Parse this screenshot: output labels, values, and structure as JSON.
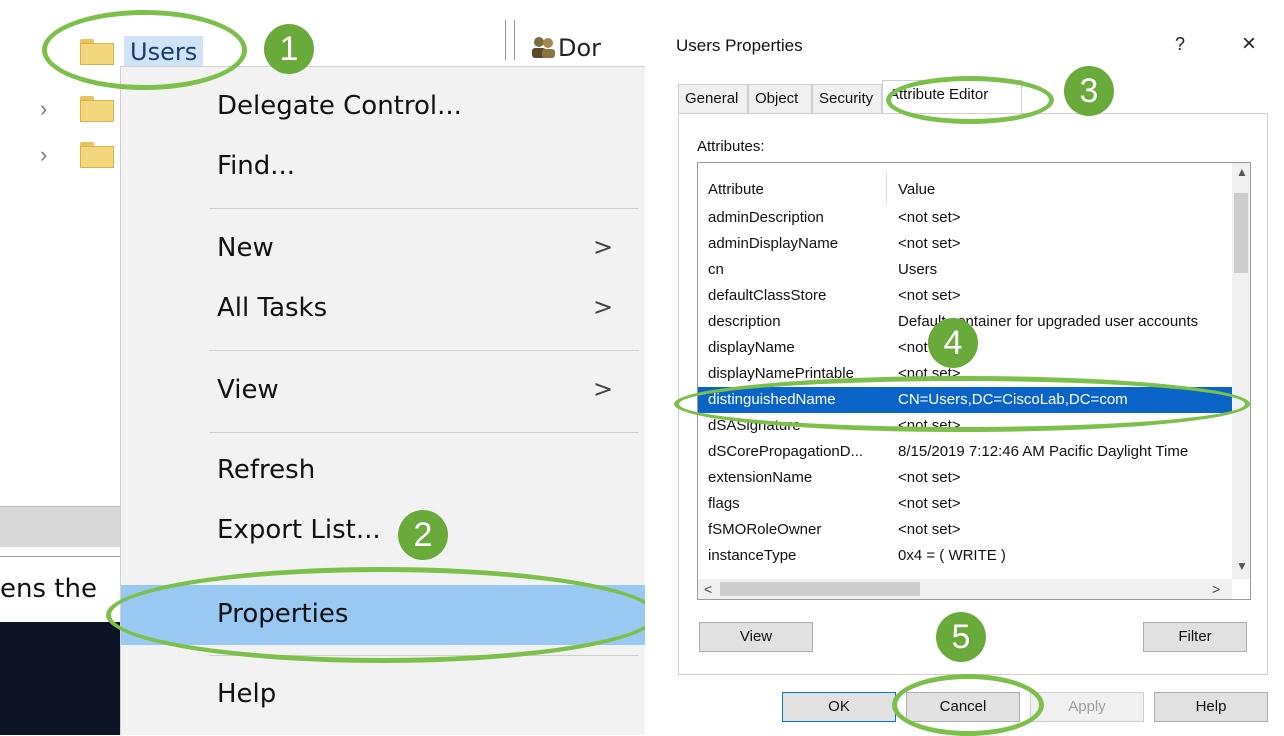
{
  "left": {
    "tree": {
      "selected_label": "Users"
    },
    "console_partial": {
      "column_header": "Dor",
      "status_text": "ens the"
    },
    "context_menu": {
      "items": [
        {
          "label": "Delegate Control...",
          "submenu": false
        },
        {
          "label": "Find...",
          "submenu": false
        },
        {
          "label": "New",
          "submenu": true
        },
        {
          "label": "All Tasks",
          "submenu": true
        },
        {
          "label": "View",
          "submenu": true
        },
        {
          "label": "Refresh",
          "submenu": false
        },
        {
          "label": "Export List...",
          "submenu": false
        },
        {
          "label": "Properties",
          "submenu": false,
          "highlighted": true
        },
        {
          "label": "Help",
          "submenu": false
        }
      ],
      "submenu_arrow": ">"
    }
  },
  "dialog": {
    "title": "Users Properties",
    "help_glyph": "?",
    "close_glyph": "×",
    "tabs": [
      "General",
      "Object",
      "Security",
      "Attribute Editor"
    ],
    "active_tab": "Attribute Editor",
    "attributes_label": "Attributes:",
    "columns": {
      "attribute": "Attribute",
      "value": "Value"
    },
    "rows": [
      {
        "attribute": "adminDescription",
        "value": "<not set>"
      },
      {
        "attribute": "adminDisplayName",
        "value": "<not set>"
      },
      {
        "attribute": "cn",
        "value": "Users"
      },
      {
        "attribute": "defaultClassStore",
        "value": "<not set>"
      },
      {
        "attribute": "description",
        "value": "Default container for upgraded user accounts"
      },
      {
        "attribute": "displayName",
        "value": "<not set>"
      },
      {
        "attribute": "displayNamePrintable",
        "value": "<not set>"
      },
      {
        "attribute": "distinguishedName",
        "value": "CN=Users,DC=CiscoLab,DC=com",
        "selected": true
      },
      {
        "attribute": "dSASignature",
        "value": "<not set>"
      },
      {
        "attribute": "dSCorePropagationD...",
        "value": "8/15/2019 7:12:46 AM Pacific Daylight Time"
      },
      {
        "attribute": "extensionName",
        "value": "<not set>"
      },
      {
        "attribute": "flags",
        "value": "<not set>"
      },
      {
        "attribute": "fSMORoleOwner",
        "value": "<not set>"
      },
      {
        "attribute": "instanceType",
        "value": "0x4 = ( WRITE )"
      }
    ],
    "buttons": {
      "view": "View",
      "filter": "Filter",
      "ok": "OK",
      "cancel": "Cancel",
      "apply": "Apply",
      "help": "Help"
    }
  },
  "annotations": {
    "steps": [
      "1",
      "2",
      "3",
      "4",
      "5"
    ],
    "color": "#7cbf4a"
  }
}
